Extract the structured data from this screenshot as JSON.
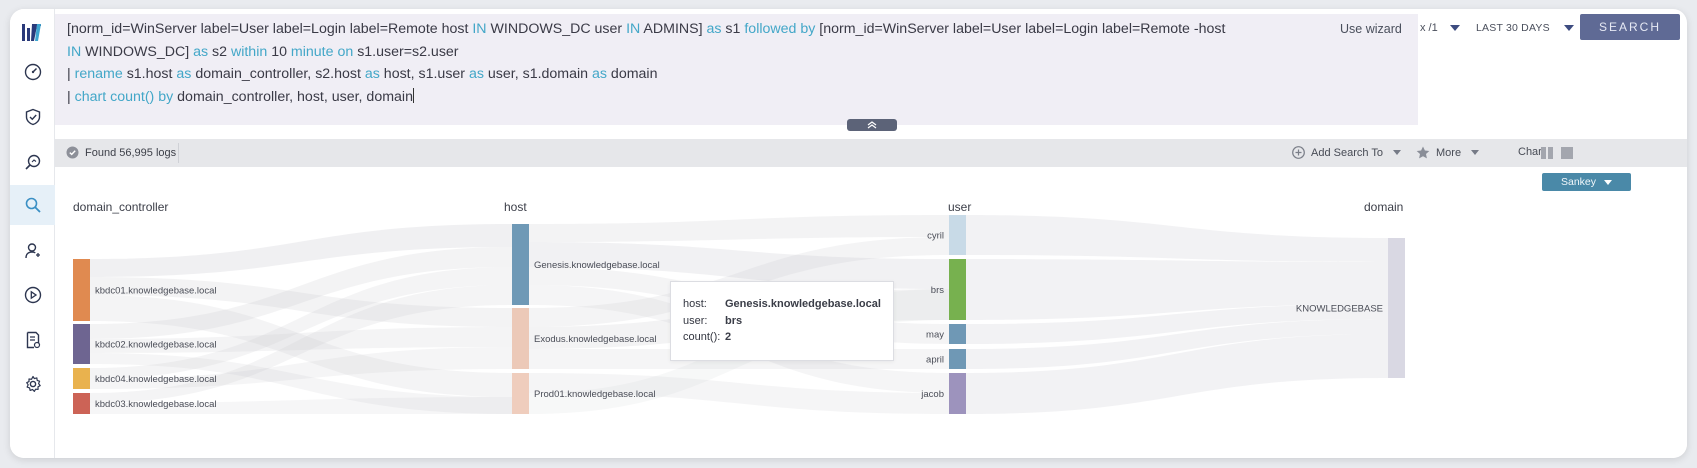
{
  "query": {
    "lines": [
      [
        {
          "t": "[norm_id=WinServer label=User label=Login label=Remote host ",
          "k": false
        },
        {
          "t": "IN",
          "k": true
        },
        {
          "t": " WINDOWS_DC user ",
          "k": false
        },
        {
          "t": "IN",
          "k": true
        },
        {
          "t": " ADMINS] ",
          "k": false
        },
        {
          "t": "as",
          "k": true
        },
        {
          "t": " s1 ",
          "k": false
        },
        {
          "t": "followed by",
          "k": true
        },
        {
          "t": " [norm_id=WinServer label=User label=Login label=Remote -host",
          "k": false
        }
      ],
      [
        {
          "t": "IN",
          "k": true
        },
        {
          "t": " WINDOWS_DC] ",
          "k": false
        },
        {
          "t": "as",
          "k": true
        },
        {
          "t": " s2 ",
          "k": false
        },
        {
          "t": "within",
          "k": true
        },
        {
          "t": " 10 ",
          "k": false
        },
        {
          "t": "minute",
          "k": true
        },
        {
          "t": " ",
          "k": false
        },
        {
          "t": "on",
          "k": true
        },
        {
          "t": " s1.user=s2.user",
          "k": false
        }
      ],
      [
        {
          "t": "| ",
          "k": false
        },
        {
          "t": "rename",
          "k": true
        },
        {
          "t": " s1.host ",
          "k": false
        },
        {
          "t": "as",
          "k": true
        },
        {
          "t": " domain_controller, s2.host ",
          "k": false
        },
        {
          "t": "as",
          "k": true
        },
        {
          "t": " host, s1.user ",
          "k": false
        },
        {
          "t": "as",
          "k": true
        },
        {
          "t": " user, s1.domain ",
          "k": false
        },
        {
          "t": "as",
          "k": true
        },
        {
          "t": " domain",
          "k": false
        }
      ],
      [
        {
          "t": "| ",
          "k": false
        },
        {
          "t": "chart count()",
          "k": true
        },
        {
          "t": " ",
          "k": false
        },
        {
          "t": "by",
          "k": true
        },
        {
          "t": " domain_controller, host, user, domain",
          "k": false
        }
      ]
    ]
  },
  "toolbar": {
    "use_wizard": "Use wizard",
    "repo_selector": "x /1",
    "time_range": "LAST 30 DAYS",
    "search_label": "SEARCH"
  },
  "results": {
    "found_text": "Found 56,995 logs",
    "add_search_to": "Add Search To",
    "more": "More",
    "chart_label": "Chart"
  },
  "chart_data": {
    "type": "sankey",
    "chart_type_label": "Sankey",
    "columns": [
      "domain_controller",
      "host",
      "user",
      "domain"
    ],
    "nodes": {
      "domain_controller": [
        {
          "name": "kbdc01.knowledgebase.local",
          "color": "#e08a50"
        },
        {
          "name": "kbdc02.knowledgebase.local",
          "color": "#6e6591"
        },
        {
          "name": "kbdc04.knowledgebase.local",
          "color": "#e9b24e"
        },
        {
          "name": "kbdc03.knowledgebase.local",
          "color": "#cc6356"
        }
      ],
      "host": [
        {
          "name": "Genesis.knowledgebase.local",
          "color": "#6f99b6"
        },
        {
          "name": "Exodus.knowledgebase.local",
          "color": "#ecc9b8"
        },
        {
          "name": "Prod01.knowledgebase.local",
          "color": "#efcdbd"
        }
      ],
      "user": [
        {
          "name": "cyril",
          "color": "#c8dae7"
        },
        {
          "name": "brs",
          "color": "#77b14f"
        },
        {
          "name": "may",
          "color": "#6f98b5"
        },
        {
          "name": "april",
          "color": "#6f98b5"
        },
        {
          "name": "jacob",
          "color": "#9d93bd"
        }
      ],
      "domain": [
        {
          "name": "KNOWLEDGEBASE",
          "color": "#d9d8e3"
        }
      ]
    },
    "tooltip": {
      "rows": [
        {
          "key": "host:",
          "value": "Genesis.knowledgebase.local"
        },
        {
          "key": "user:",
          "value": "brs"
        },
        {
          "key": "count():",
          "value": "2"
        }
      ]
    }
  }
}
